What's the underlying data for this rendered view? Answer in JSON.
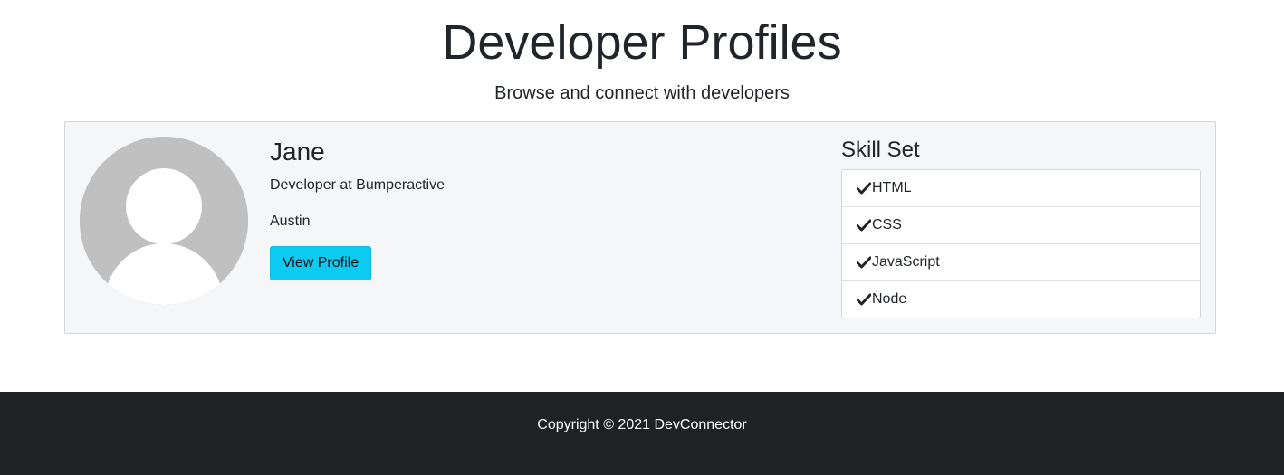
{
  "header": {
    "title": "Developer Profiles",
    "subtitle": "Browse and connect with developers"
  },
  "profiles": [
    {
      "avatar_icon": "user-silhouette-icon",
      "name": "Jane",
      "status": "Developer at Bumperactive",
      "location": "Austin",
      "view_profile_label": "View Profile",
      "skills_heading": "Skill Set",
      "skills": [
        "HTML",
        "CSS",
        "JavaScript",
        "Node"
      ]
    }
  ],
  "footer": {
    "copyright": "Copyright © 2021 DevConnector"
  },
  "colors": {
    "button": "#0dcaf0",
    "card_background": "#f5f6f8",
    "footer_background": "#1f2225"
  }
}
